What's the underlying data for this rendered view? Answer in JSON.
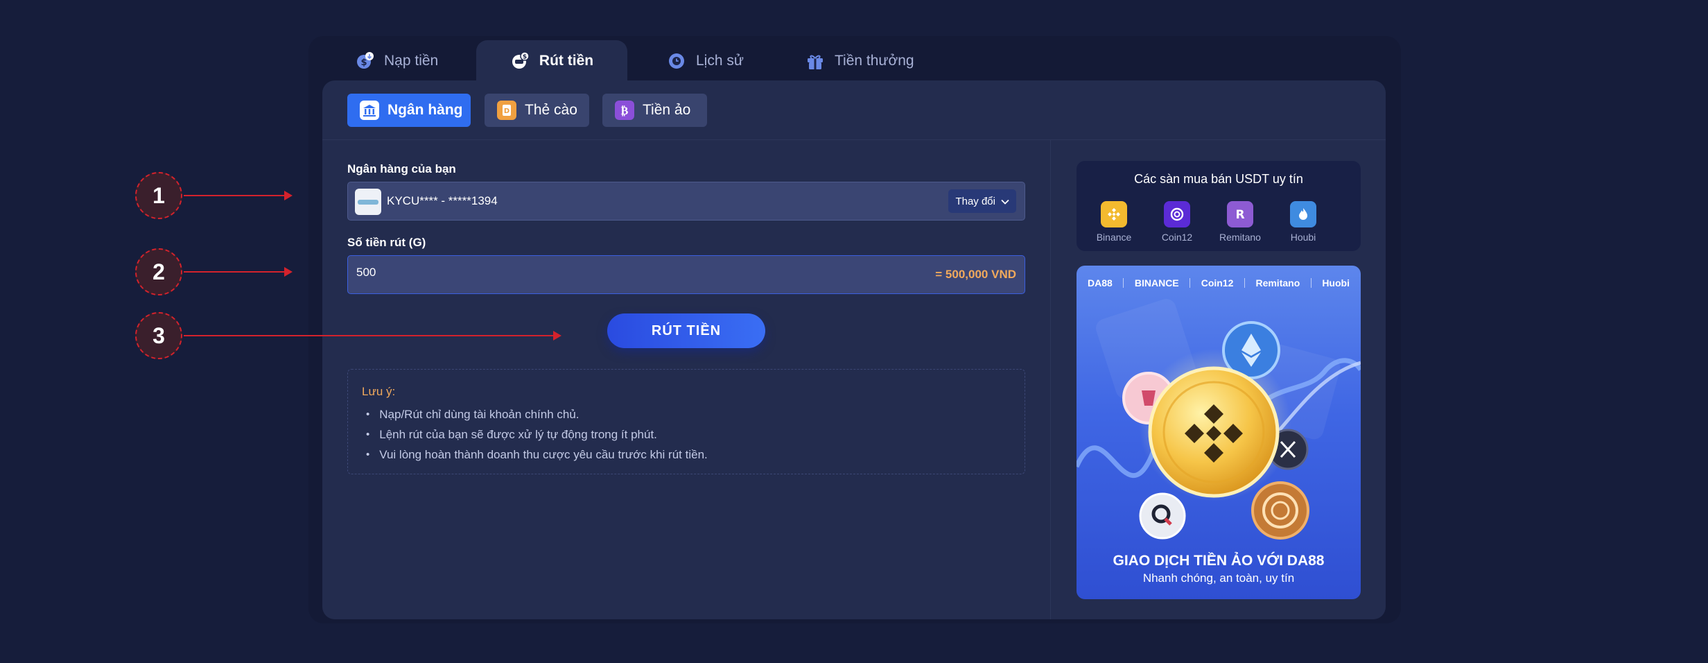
{
  "tabs": [
    {
      "label": "Nạp tiền",
      "icon": "deposit-coin-icon"
    },
    {
      "label": "Rút tiền",
      "icon": "withdraw-coin-icon",
      "active": true
    },
    {
      "label": "Lịch sử",
      "icon": "clock-history-icon"
    },
    {
      "label": "Tiền thưởng",
      "icon": "gift-icon"
    }
  ],
  "subtabs": [
    {
      "label": "Ngân hàng",
      "icon": "bank-icon",
      "active": true
    },
    {
      "label": "Thẻ cào",
      "icon": "scratch-card-icon"
    },
    {
      "label": "Tiền ảo",
      "icon": "bitcoin-icon"
    }
  ],
  "form": {
    "bank_label": "Ngân hàng của bạn",
    "bank_account": "KYCU**** - *****1394",
    "change_label": "Thay đổi",
    "amount_label": "Số tiền rút (G)",
    "amount_value": "500",
    "conversion": "= 500,000 VND",
    "submit_label": "RÚT TIỀN"
  },
  "note": {
    "title": "Lưu ý:",
    "items": [
      "Nạp/Rút chỉ dùng tài khoản chính chủ.",
      "Lệnh rút của bạn sẽ được xử lý tự động trong ít phút.",
      "Vui lòng hoàn thành doanh thu cược yêu cầu trước khi rút tiền."
    ]
  },
  "annotations": [
    "1",
    "2",
    "3"
  ],
  "exchanges": {
    "title": "Các sàn mua bán USDT uy tín",
    "items": [
      {
        "name": "Binance",
        "icon": "binance-icon",
        "color": "#f3ba2f"
      },
      {
        "name": "Coin12",
        "icon": "coin12-icon",
        "color": "#5b2bd6"
      },
      {
        "name": "Remitano",
        "icon": "remitano-icon",
        "color": "#8d5bd3"
      },
      {
        "name": "Houbi",
        "icon": "huobi-icon",
        "color": "#3f8be0"
      }
    ]
  },
  "banner": {
    "logos": [
      "DA88",
      "BINANCE",
      "Coin12",
      "Remitano",
      "Huobi"
    ],
    "title": "GIAO DỊCH TIỀN ẢO VỚI DA88",
    "subtitle": "Nhanh chóng, an toàn, uy tín"
  },
  "colors": {
    "background": "#161d3b",
    "panel": "#232c4e",
    "accent": "#2f6df0",
    "highlight": "#f0a95c",
    "annotation": "#d3222c"
  }
}
